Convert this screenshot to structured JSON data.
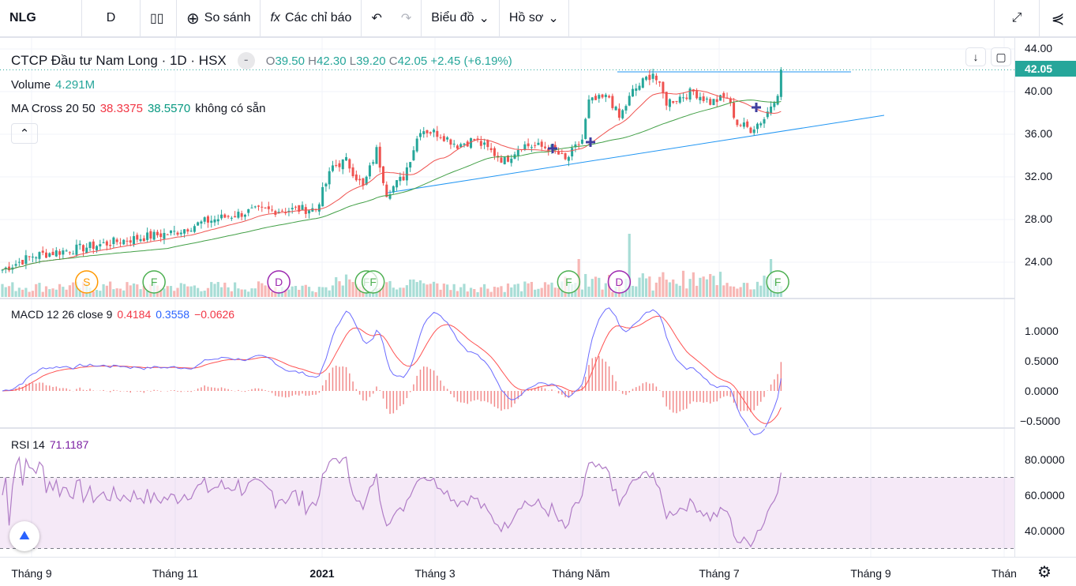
{
  "toolbar": {
    "symbol": "NLG",
    "interval": "D",
    "compare": "So sánh",
    "indicators": "Các chỉ báo",
    "chart_menu": "Biểu đồ",
    "profile_menu": "Hồ sơ"
  },
  "legend": {
    "title": "CTCP Đầu tư Nam Long · 1D · HSX",
    "o_label": "O",
    "o": "39.50",
    "h_label": "H",
    "h": "42.30",
    "l_label": "L",
    "l": "39.20",
    "c_label": "C",
    "c": "42.05",
    "change": "+2.45 (+6.19%)",
    "volume_label": "Volume",
    "volume": "4.291M",
    "ma_label": "MA Cross 20 50",
    "ma20": "38.3375",
    "ma50": "38.5570",
    "ma_na": "không có sẵn"
  },
  "macd_legend": {
    "label": "MACD 12 26 close 9",
    "macd": "0.4184",
    "signal": "0.3558",
    "hist": "−0.0626"
  },
  "rsi_legend": {
    "label": "RSI 14",
    "value": "71.1187"
  },
  "price_axis": {
    "ticks": [
      "44.00",
      "40.00",
      "36.00",
      "32.00",
      "28.00",
      "24.00"
    ],
    "last": "42.05"
  },
  "macd_axis": {
    "ticks": [
      "1.0000",
      "0.5000",
      "0.0000",
      "−0.5000"
    ]
  },
  "rsi_axis": {
    "ticks": [
      "80.0000",
      "60.0000",
      "40.0000"
    ]
  },
  "time_axis": [
    "Tháng 9",
    "Tháng 11",
    "2021",
    "Tháng 3",
    "Tháng Năm",
    "Tháng 7",
    "Tháng 9",
    "Thán"
  ],
  "colors": {
    "up": "#26a69a",
    "down": "#ef5350",
    "ma20": "#ef5350",
    "ma50": "#43a047",
    "macd": "#2962ff",
    "signal": "#ff5252",
    "rsi": "#9c27b0"
  },
  "chart_data": {
    "type": "candlestick",
    "bars": 232,
    "close_waypoints": [
      [
        0,
        23.3
      ],
      [
        9,
        24.6
      ],
      [
        23,
        25.3
      ],
      [
        35,
        26.0
      ],
      [
        51,
        26.8
      ],
      [
        60,
        27.8
      ],
      [
        74,
        28.8
      ],
      [
        93,
        29.0
      ],
      [
        98,
        33
      ],
      [
        102,
        33.5
      ],
      [
        107,
        31
      ],
      [
        111,
        34.5
      ],
      [
        114,
        30.5
      ],
      [
        119,
        32
      ],
      [
        124,
        36.5
      ],
      [
        130,
        36
      ],
      [
        135,
        35
      ],
      [
        140,
        35.5
      ],
      [
        149,
        33.5
      ],
      [
        154,
        35
      ],
      [
        163,
        34.7
      ],
      [
        167,
        33.5
      ],
      [
        172,
        35.5
      ],
      [
        174,
        39
      ],
      [
        180,
        39.5
      ],
      [
        183,
        37.5
      ],
      [
        187,
        40
      ],
      [
        193,
        41.8
      ],
      [
        197,
        39
      ],
      [
        201,
        39.5
      ],
      [
        205,
        40
      ],
      [
        210,
        39
      ],
      [
        215,
        39.5
      ],
      [
        218,
        37
      ],
      [
        222,
        36.5
      ],
      [
        226,
        37.5
      ],
      [
        230,
        40
      ],
      [
        231,
        42.05
      ]
    ],
    "events": [
      {
        "letter": "S",
        "bar": 25,
        "color": "#ff9800"
      },
      {
        "letter": "F",
        "bar": 45,
        "color": "#4caf50"
      },
      {
        "letter": "D",
        "bar": 82,
        "color": "#9c27b0"
      },
      {
        "letter": "F",
        "bar": 108,
        "color": "#4caf50"
      },
      {
        "letter": "F",
        "bar": 110,
        "color": "#4caf50"
      },
      {
        "letter": "F",
        "bar": 168,
        "color": "#4caf50"
      },
      {
        "letter": "D",
        "bar": 183,
        "color": "#9c27b0"
      },
      {
        "letter": "F",
        "bar": 230,
        "color": "#4caf50"
      }
    ],
    "price_range": [
      21.5,
      45
    ],
    "macd_range": [
      -0.7,
      1.5
    ],
    "rsi_range": [
      25,
      97
    ],
    "rsi_bands": [
      30,
      70
    ]
  }
}
